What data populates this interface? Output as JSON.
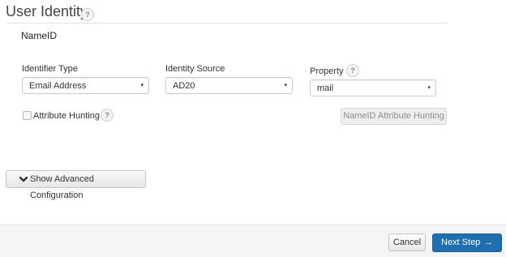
{
  "section": {
    "title": "User Identity",
    "help_glyph": "?",
    "subheading": "NameID"
  },
  "fields": {
    "identifier_type": {
      "label": "Identifier Type",
      "value": "Email Address"
    },
    "identity_source": {
      "label": "Identity Source",
      "value": "AD20"
    },
    "property": {
      "label": "Property",
      "value": "mail",
      "help_glyph": "?"
    }
  },
  "attribute_hunting": {
    "label": "Attribute Hunting",
    "checked": false,
    "help_glyph": "?",
    "button_label": "NameID Attribute Hunting",
    "button_disabled": true
  },
  "advanced": {
    "label": "Show Advanced Configuration",
    "icon": "chevron-down-icon"
  },
  "footer": {
    "cancel_label": "Cancel",
    "next_label": "Next Step",
    "next_icon": "arrow-right-icon",
    "next_color": "#1f6fb0"
  },
  "icons": {
    "caret": "▾",
    "chevron": "❯",
    "arrow": "→"
  }
}
